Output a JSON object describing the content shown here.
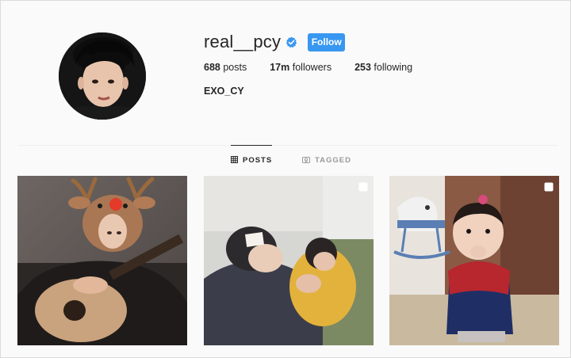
{
  "profile": {
    "username": "real__pcy",
    "verified": true,
    "follow_label": "Follow",
    "posts_count": "688",
    "posts_label": "posts",
    "followers_count": "17m",
    "followers_label": "followers",
    "following_count": "253",
    "following_label": "following",
    "full_name": "EXO_CY"
  },
  "tabs": [
    {
      "label": "POSTS",
      "icon": "grid-icon",
      "active": true
    },
    {
      "label": "TAGGED",
      "icon": "tag-icon",
      "active": false
    }
  ],
  "posts": [
    {
      "description": "guitar-photo",
      "multi": false
    },
    {
      "description": "baby-photo",
      "multi": true
    },
    {
      "description": "child-photo",
      "multi": true
    }
  ],
  "colors": {
    "accent": "#3897f0",
    "verified": "#3897f0",
    "text": "#262626",
    "muted": "#999999",
    "background": "#fafafa"
  }
}
